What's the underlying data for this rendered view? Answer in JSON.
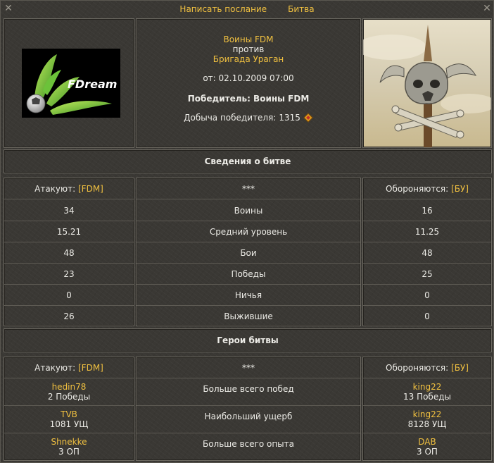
{
  "nav": {
    "write_message": "Написать послание",
    "battle": "Битва"
  },
  "header": {
    "clan_logo_text": "FDream",
    "attacker_clan": "Воины FDM",
    "versus": "против",
    "defender_clan": "Бригада Ураган",
    "date": "от: 02.10.2009 07:00",
    "winner": "Победитель: Воины FDM",
    "loot_label": "Добыча победителя:",
    "loot_value": "1315"
  },
  "battle_info": {
    "title": "Сведения о битве",
    "attackers_label": "Атакуют:",
    "attackers_tag": "[FDM]",
    "middle_header": "***",
    "defenders_label": "Обороняются:",
    "defenders_tag": "[БУ]",
    "rows": [
      {
        "left": "34",
        "label": "Воины",
        "right": "16"
      },
      {
        "left": "15.21",
        "label": "Средний уровень",
        "right": "11.25"
      },
      {
        "left": "48",
        "label": "Бои",
        "right": "48"
      },
      {
        "left": "23",
        "label": "Победы",
        "right": "25"
      },
      {
        "left": "0",
        "label": "Ничья",
        "right": "0"
      },
      {
        "left": "26",
        "label": "Выжившие",
        "right": "0"
      }
    ]
  },
  "heroes": {
    "title": "Герои битвы",
    "attackers_label": "Атакуют:",
    "attackers_tag": "[FDM]",
    "middle_header": "***",
    "defenders_label": "Обороняются:",
    "defenders_tag": "[БУ]",
    "rows": [
      {
        "left_name": "hedin78",
        "left_value": "2 Победы",
        "label": "Больше всего побед",
        "right_name": "king22",
        "right_value": "13 Победы"
      },
      {
        "left_name": "TVB",
        "left_value": "1081 УЩ",
        "label": "Наибольший ущерб",
        "right_name": "king22",
        "right_value": "8128 УЩ"
      },
      {
        "left_name": "Shnekke",
        "left_value": "3 ОП",
        "label": "Больше всего опыта",
        "right_name": "DAB",
        "right_value": "3 ОП"
      }
    ]
  }
}
